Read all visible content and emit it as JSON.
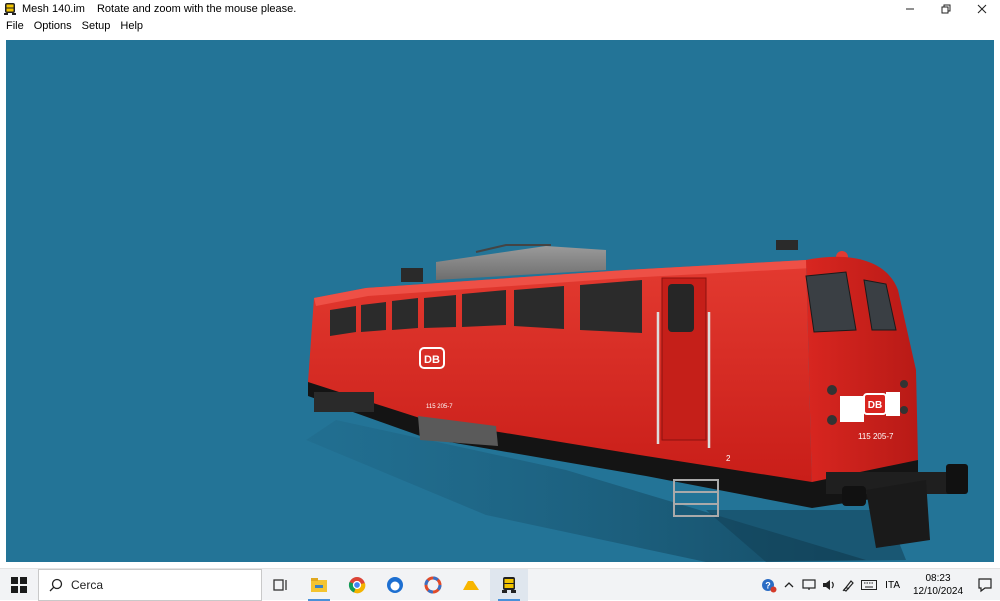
{
  "window": {
    "app_name": "Mesh 140.im",
    "message": "Rotate and zoom with the mouse please."
  },
  "menu": [
    "File",
    "Options",
    "Setup",
    "Help"
  ],
  "viewport": {
    "background": "#237497",
    "model": {
      "body_number_side": "115 205-7",
      "body_number_front": "115 205-7",
      "logo_text": "DB",
      "bogie_number": "2",
      "body_color": "#d9241f",
      "base_color": "#111111"
    }
  },
  "taskbar": {
    "search_placeholder": "Cerca",
    "language": "ITA",
    "time": "08:23",
    "date": "12/10/2024"
  }
}
